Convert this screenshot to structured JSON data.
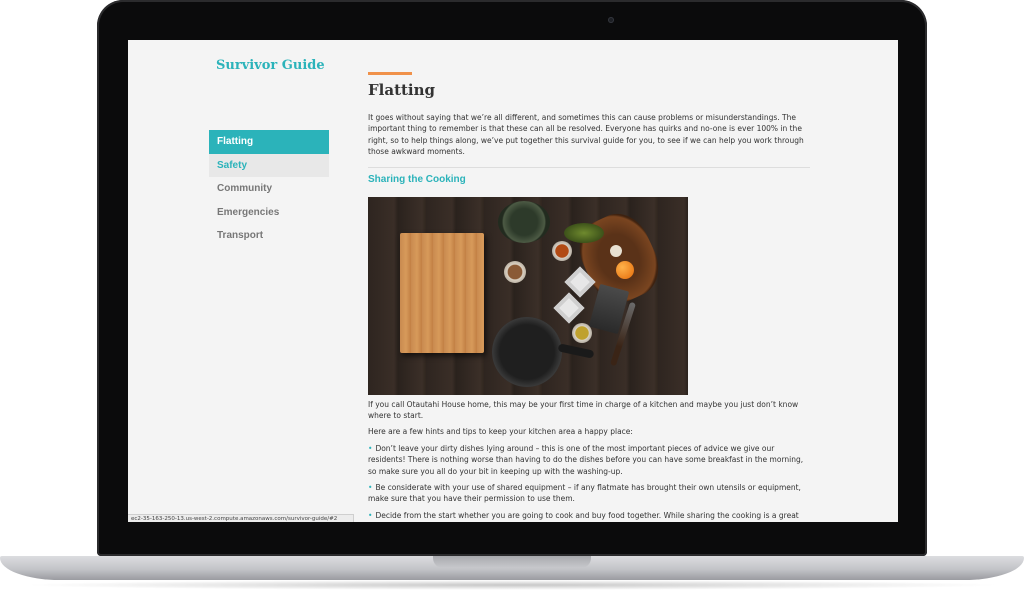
{
  "site": {
    "title": "Survivor Guide"
  },
  "nav": {
    "items": [
      {
        "label": "Flatting",
        "state": "active"
      },
      {
        "label": "Safety",
        "state": "hover"
      },
      {
        "label": "Community",
        "state": "normal"
      },
      {
        "label": "Emergencies",
        "state": "normal"
      },
      {
        "label": "Transport",
        "state": "normal"
      }
    ]
  },
  "page": {
    "title": "Flatting",
    "intro": "It goes without saying that we’re all different, and sometimes this can cause problems or misunderstandings. The important thing to remember is that these can all be resolved. Everyone has quirks and no-one is ever 100% in the right, so to help things along, we’ve put together this survival guide for you, to see if we can help you work through those awkward moments.",
    "section_heading": "Sharing the Cooking",
    "para1": "If you call Otautahi House home, this may be your first time in charge of a kitchen and maybe you just don’t know where to start.",
    "para2": "Here are a few hints and tips to keep your kitchen area a happy place:",
    "tips": [
      "Don’t leave your dirty dishes lying around – this is one of the most important pieces of advice we give our residents! There is nothing worse than having to do the dishes before you can have some breakfast in the morning, so make sure you all do your bit in keeping up with the washing-up.",
      "Be considerate with your use of shared equipment – if any flatmate has brought their own utensils or equipment, make sure that you have their permission to use them.",
      "Decide from the start whether you are going to cook and buy food together. While sharing the cooking is a great way of minimizing costs, it isn’t perfect for everyone. To begin with, you have to consider whether you have similar tastes and"
    ],
    "bullet": "•"
  },
  "status_bar": {
    "url": "ec2-35-163-250-13.us-west-2.compute.amazonaws.com/survivor-guide/#2"
  },
  "colors": {
    "accent": "#2bb3ba",
    "title_bar": "#f0914a",
    "text": "#333333",
    "nav_text": "#777777"
  },
  "icons": {
    "laptop": "macbook-frame-icon",
    "camera": "camera-icon"
  }
}
